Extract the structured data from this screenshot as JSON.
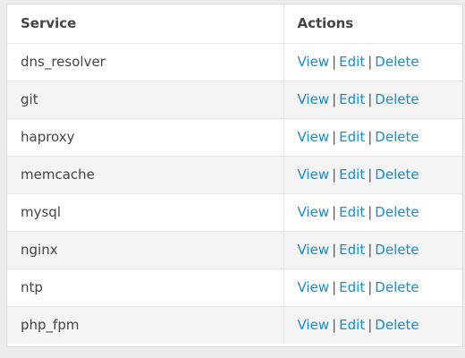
{
  "table": {
    "headers": {
      "service": "Service",
      "actions": "Actions"
    },
    "separator": "|",
    "action_labels": {
      "view": "View",
      "edit": "Edit",
      "delete": "Delete"
    },
    "rows": [
      {
        "service": "dns_resolver"
      },
      {
        "service": "git"
      },
      {
        "service": "haproxy"
      },
      {
        "service": "memcache"
      },
      {
        "service": "mysql"
      },
      {
        "service": "nginx"
      },
      {
        "service": "ntp"
      },
      {
        "service": "php_fpm"
      }
    ]
  },
  "colors": {
    "link": "#1a8cc9",
    "text": "#444444",
    "stripe": "#f4f4f4",
    "background": "#ececec"
  }
}
